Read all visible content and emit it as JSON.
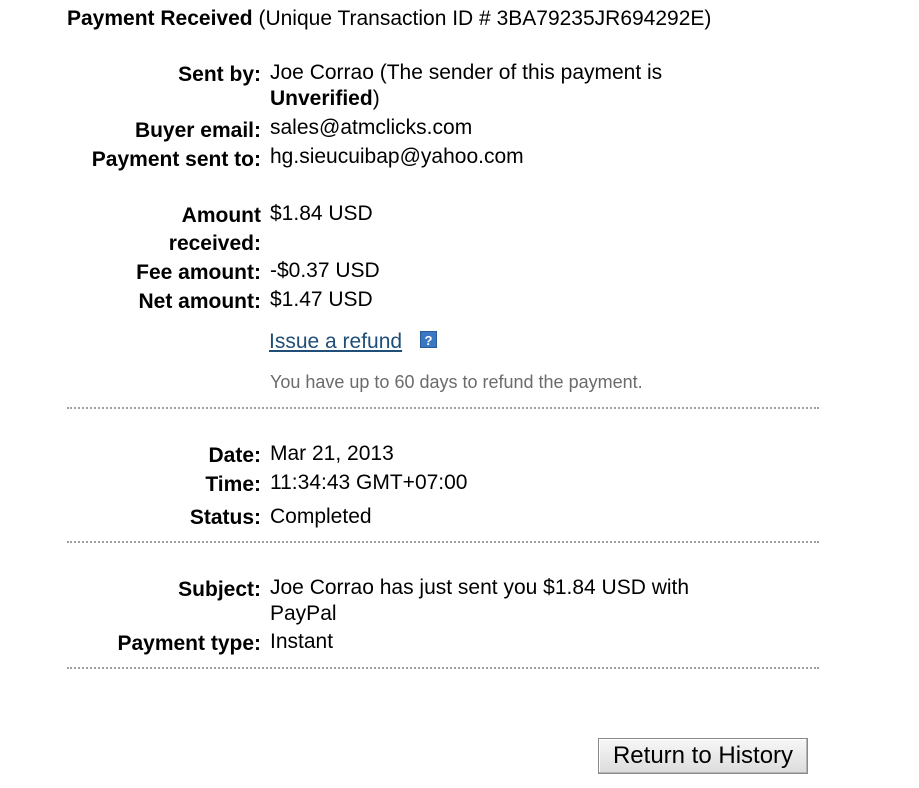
{
  "header": {
    "title": "Payment Received",
    "transaction": "(Unique Transaction ID # 3BA79235JR694292E)"
  },
  "sender": {
    "sent_by_label": "Sent by:",
    "sent_by_name": "Joe Corrao (The sender of this payment is",
    "sent_by_status": "Unverified",
    "sent_by_close": ")",
    "buyer_email_label": "Buyer email:",
    "buyer_email": "sales@atmclicks.com",
    "payment_sent_to_label": "Payment sent to:",
    "payment_sent_to": "hg.sieucuibap@yahoo.com"
  },
  "amounts": {
    "amount_received_label_1": "Amount",
    "amount_received_label_2": "received:",
    "amount_received": "$1.84 USD",
    "fee_label": "Fee amount:",
    "fee": "-$0.37 USD",
    "net_label": "Net amount:",
    "net": "$1.47 USD",
    "refund_link": "Issue a refund",
    "help_icon_glyph": "?",
    "refund_note": "You have up to 60 days to refund the payment."
  },
  "timing": {
    "date_label": "Date:",
    "date": "Mar 21, 2013",
    "time_label": "Time:",
    "time": "11:34:43 GMT+07:00",
    "status_label": "Status:",
    "status": "Completed"
  },
  "details": {
    "subject_label": "Subject:",
    "subject_line1": "Joe Corrao has just sent you $1.84 USD with",
    "subject_line2": "PayPal",
    "payment_type_label": "Payment type:",
    "payment_type": "Instant"
  },
  "actions": {
    "return_button": "Return to History"
  },
  "colors": {
    "link": "#1f4e79",
    "help_icon": "#3a78c4",
    "note_text": "#6b6b6b",
    "divider": "#a0a0a0"
  }
}
